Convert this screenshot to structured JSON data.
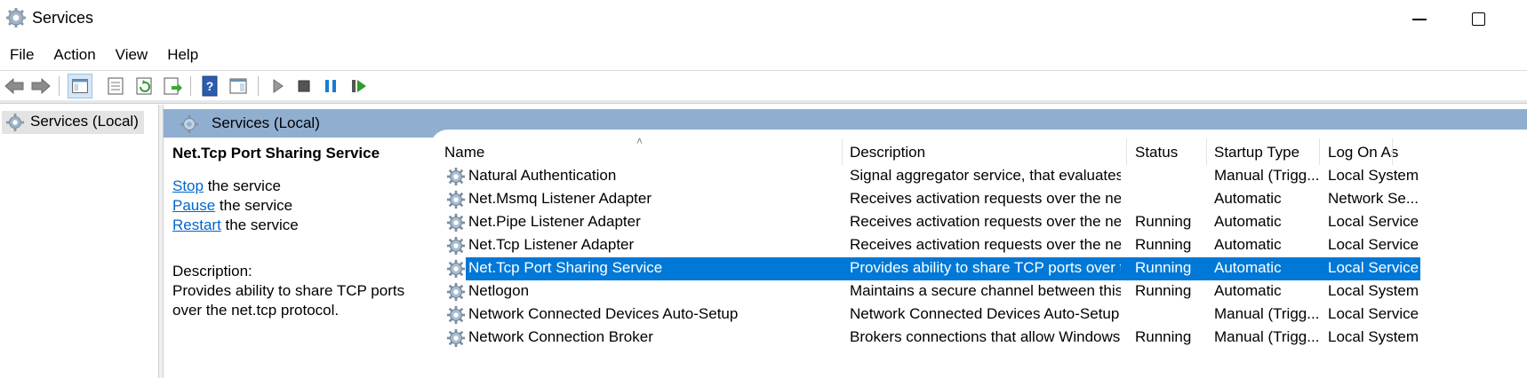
{
  "window": {
    "title": "Services"
  },
  "menu": [
    "File",
    "Action",
    "View",
    "Help"
  ],
  "tree": {
    "root_label": "Services (Local)"
  },
  "header": {
    "title": "Services (Local)"
  },
  "details": {
    "service_title": "Net.Tcp Port Sharing Service",
    "actions": [
      {
        "link": "Stop",
        "rest": " the service"
      },
      {
        "link": "Pause",
        "rest": " the service"
      },
      {
        "link": "Restart",
        "rest": " the service"
      }
    ],
    "description_label": "Description:",
    "description_text": "Provides ability to share TCP ports over the net.tcp protocol."
  },
  "table": {
    "columns": [
      "Name",
      "Description",
      "Status",
      "Startup Type",
      "Log On As"
    ],
    "sorted_column": "Name",
    "selected_row": 4,
    "rows": [
      {
        "name": "Natural Authentication",
        "description": "Signal aggregator service, that evaluates ...",
        "status": "",
        "startup": "Manual (Trigg...",
        "logon": "Local System"
      },
      {
        "name": "Net.Msmq Listener Adapter",
        "description": "Receives activation requests over the net....",
        "status": "",
        "startup": "Automatic",
        "logon": "Network Se..."
      },
      {
        "name": "Net.Pipe Listener Adapter",
        "description": "Receives activation requests over the net....",
        "status": "Running",
        "startup": "Automatic",
        "logon": "Local Service"
      },
      {
        "name": "Net.Tcp Listener Adapter",
        "description": "Receives activation requests over the net....",
        "status": "Running",
        "startup": "Automatic",
        "logon": "Local Service"
      },
      {
        "name": "Net.Tcp Port Sharing Service",
        "description": "Provides ability to share TCP ports over t...",
        "status": "Running",
        "startup": "Automatic",
        "logon": "Local Service"
      },
      {
        "name": "Netlogon",
        "description": "Maintains a secure channel between this ...",
        "status": "Running",
        "startup": "Automatic",
        "logon": "Local System"
      },
      {
        "name": "Network Connected Devices Auto-Setup",
        "description": "Network Connected Devices Auto-Setup ...",
        "status": "",
        "startup": "Manual (Trigg...",
        "logon": "Local Service"
      },
      {
        "name": "Network Connection Broker",
        "description": "Brokers connections that allow Windows ...",
        "status": "Running",
        "startup": "Manual (Trigg...",
        "logon": "Local System"
      }
    ]
  },
  "colors": {
    "selection": "#0078d7",
    "header_band": "#90aed0",
    "link": "#0066cc"
  },
  "icons": {
    "toolbar": [
      "back-arrow-icon",
      "forward-arrow-icon",
      "show-hide-console-tree-icon",
      "properties-icon",
      "refresh-icon",
      "export-list-icon",
      "help-icon",
      "show-hide-action-pane-icon",
      "start-service-icon",
      "stop-service-icon",
      "pause-service-icon",
      "restart-service-icon"
    ],
    "service": "gear-icon"
  }
}
